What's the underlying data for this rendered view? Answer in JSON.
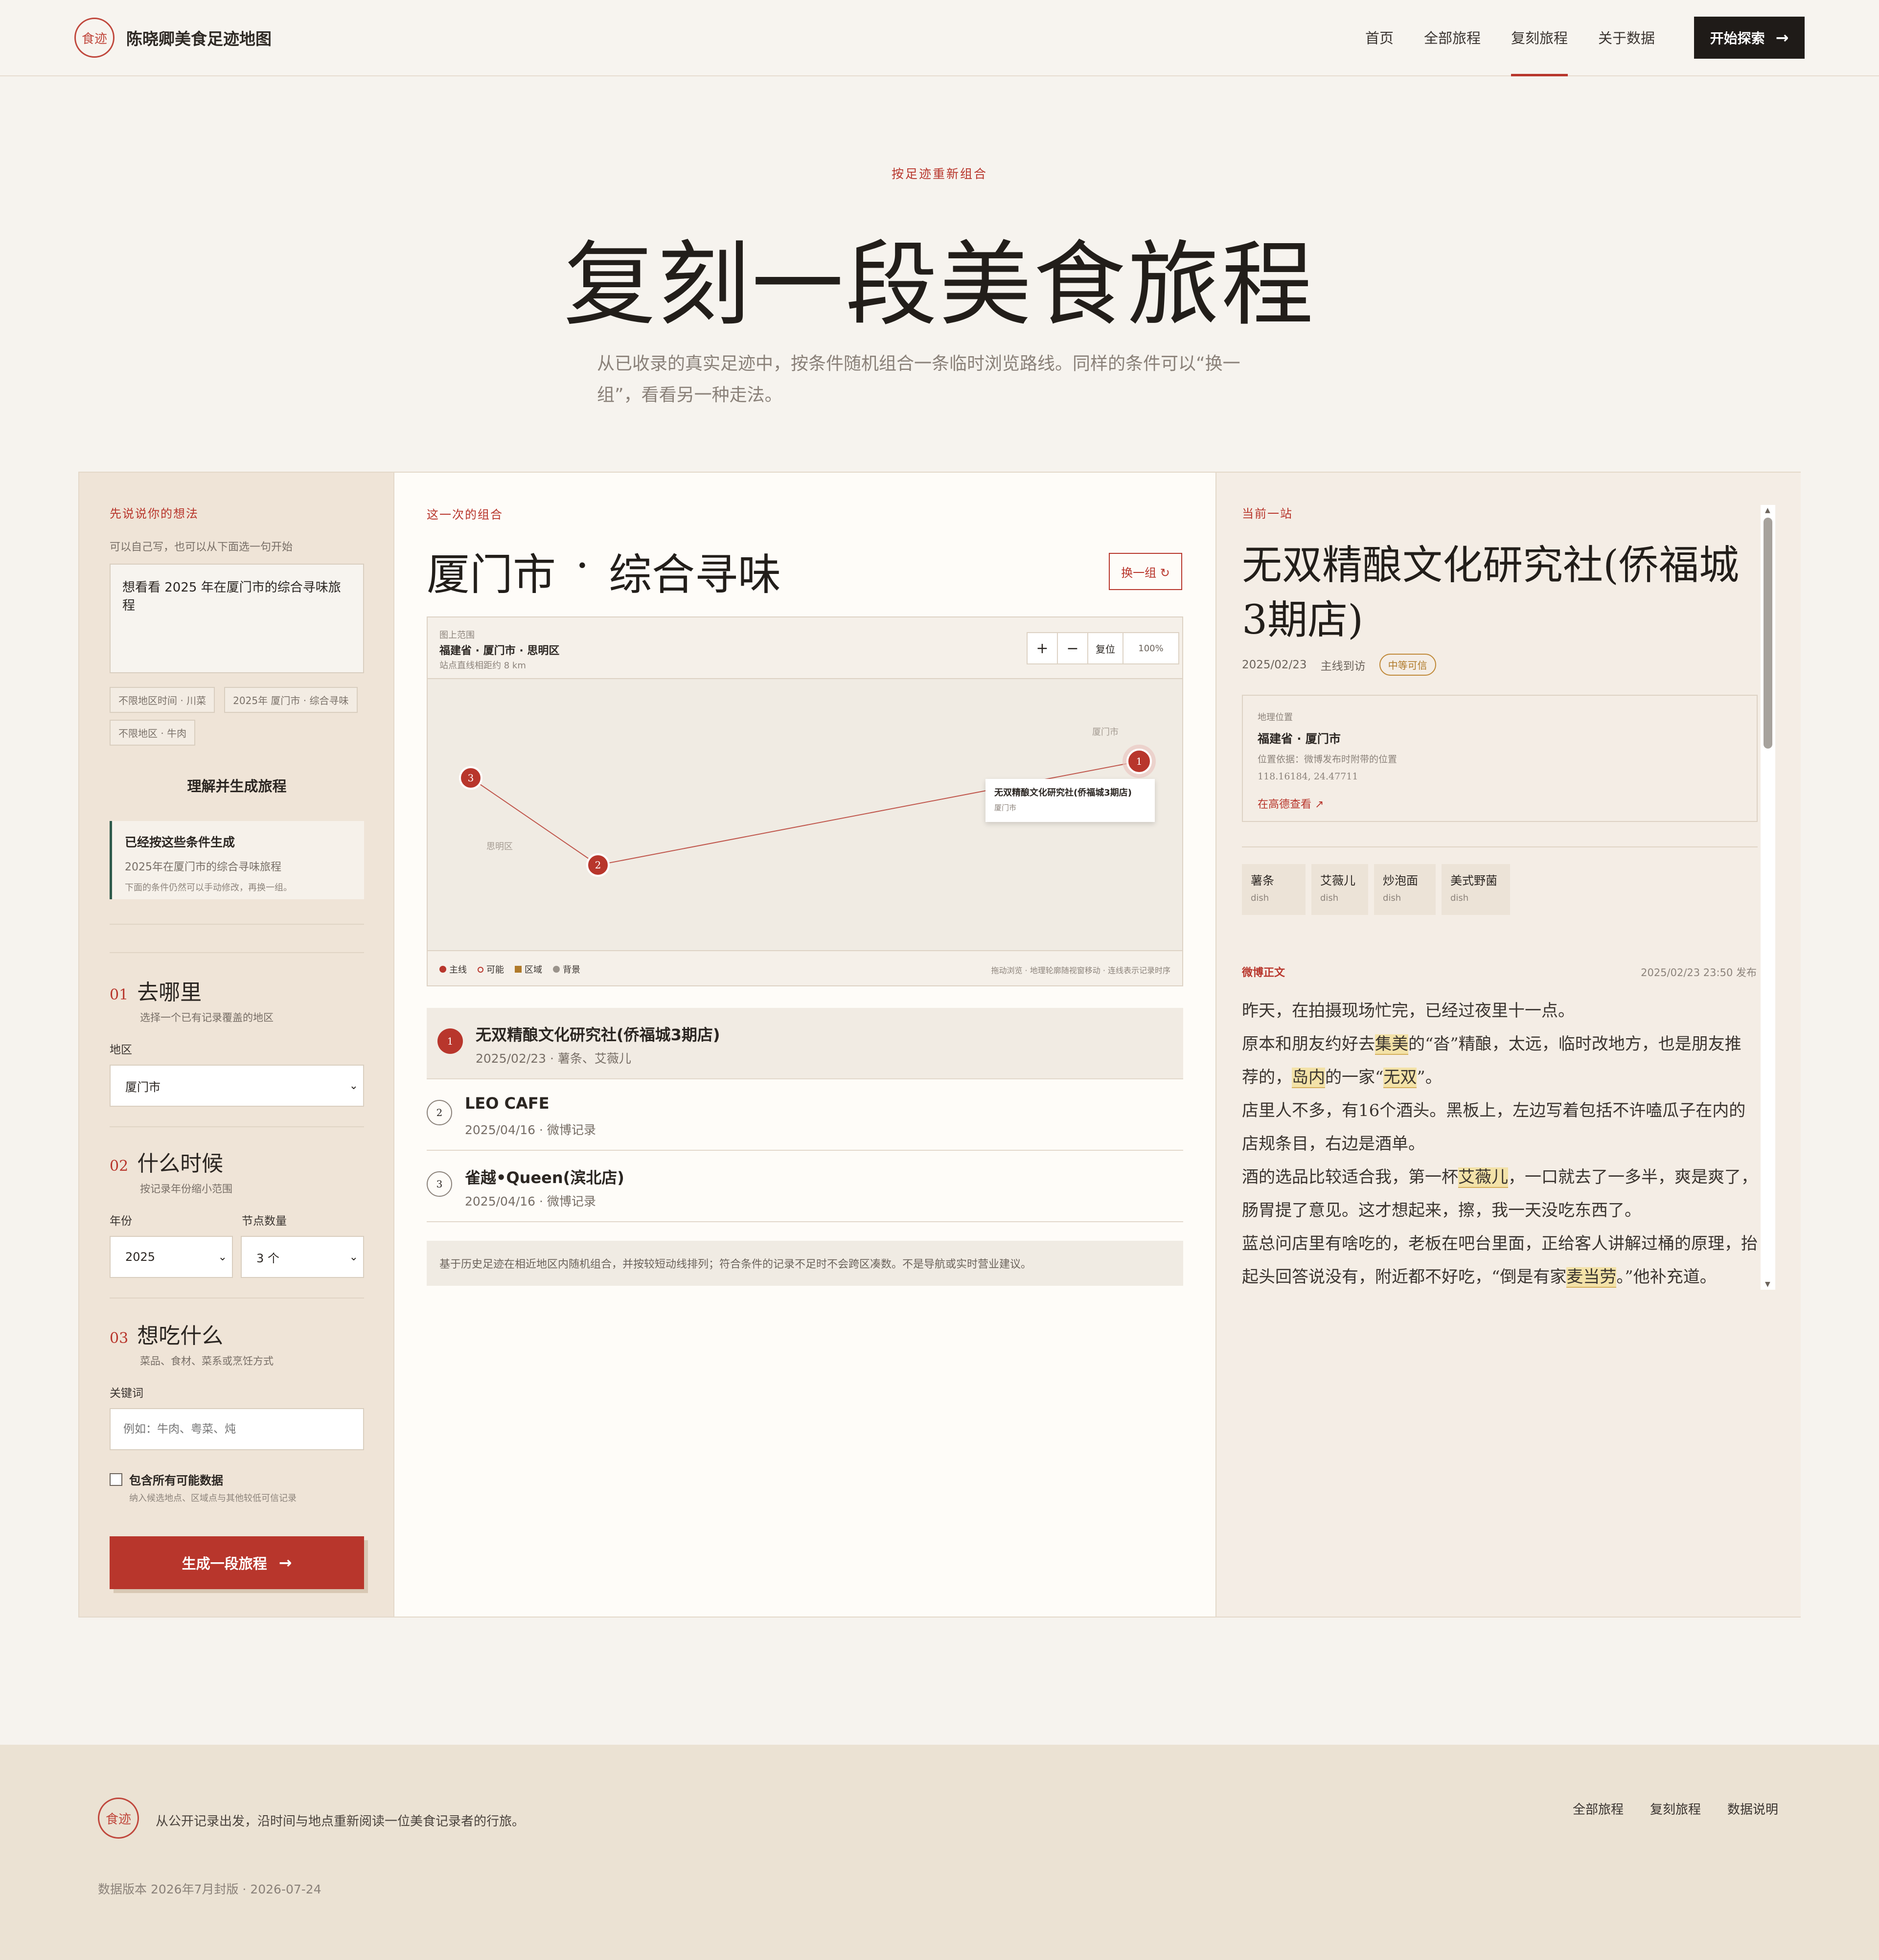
{
  "nav": {
    "logo_text": "食迹",
    "brand": "陈晓卿美食足迹地图",
    "links": [
      "首页",
      "全部旅程",
      "复刻旅程",
      "关于数据"
    ],
    "active_index": 2,
    "cta_label": "开始探索",
    "cta_arrow": "→"
  },
  "hero": {
    "eyebrow": "按足迹重新组合",
    "title": "复刻一段美食旅程",
    "description": "从已收录的真实足迹中，按条件随机组合一条临时浏览路线。同样的条件可以“换一组”，看看另一种走法。"
  },
  "left": {
    "label": "先说说你的想法",
    "hint": "可以自己写，也可以从下面选一句开始",
    "prompt_value": "想看看 2025 年在厦门市的综合寻味旅程",
    "chips": [
      "不限地区时间 · 川菜",
      "2025年 厦门市 · 综合寻味",
      "不限地区 · 牛肉"
    ],
    "parse_button": "理解并生成旅程",
    "notice_title": "已经按这些条件生成",
    "notice_line": "2025年在厦门市的综合寻味旅程",
    "notice_hint": "下面的条件仍然可以手动修改，再换一组。",
    "step1": {
      "no": "01",
      "title": "去哪里",
      "hint": "选择一个已有记录覆盖的地区",
      "field_label": "地区",
      "value": "厦门市"
    },
    "step2": {
      "no": "02",
      "title": "什么时候",
      "hint": "按记录年份缩小范围",
      "year_label": "年份",
      "year_value": "2025",
      "count_label": "节点数量",
      "count_value": "3 个"
    },
    "step3": {
      "no": "03",
      "title": "想吃什么",
      "hint": "菜品、食材、菜系或烹饪方式",
      "field_label": "关键词",
      "placeholder": "例如：牛肉、粤菜、炖"
    },
    "checkbox_label": "包含所有可能数据",
    "checkbox_hint": "纳入候选地点、区域点与其他较低可信记录",
    "checkbox_checked": false,
    "generate_button": "生成一段旅程",
    "generate_arrow": "→"
  },
  "middle": {
    "label": "这一次的组合",
    "city": "厦门市",
    "dot": "·",
    "theme": "综合寻味",
    "shuffle_label": "换一组 ↻",
    "map": {
      "scope_label": "图上范围",
      "scope": "福建省 · 厦门市 · 思明区",
      "distance": "站点直线相距约 8 km",
      "zoom_in": "+",
      "zoom_out": "−",
      "reset": "复位",
      "zoom": "100%",
      "area_label_1": "厦门市",
      "area_label_2": "思明区",
      "tooltip_title": "无双精酿文化研究社(侨福城3期店)",
      "tooltip_sub": "厦门市",
      "legend": [
        "主线",
        "可能",
        "区域",
        "背景"
      ],
      "legend_colors": [
        "#b8362c",
        "#b8362c",
        "#b07a2a",
        "#9a938b"
      ],
      "hint": "拖动浏览 · 地理轮廓随视窗移动 · 连线表示记录时序",
      "pins": [
        "1",
        "2",
        "3"
      ]
    },
    "stops": [
      {
        "no": "1",
        "name": "无双精酿文化研究社(侨福城3期店)",
        "meta": "2025/02/23 · 薯条、艾薇儿"
      },
      {
        "no": "2",
        "name": "LEO CAFE",
        "meta": "2025/04/16 · 微博记录"
      },
      {
        "no": "3",
        "name": "雀越•Queen(滨北店)",
        "meta": "2025/04/16 · 微博记录"
      }
    ],
    "disclaimer": "基于历史足迹在相近地区内随机组合，并按较短动线排列；符合条件的记录不足时不会跨区凑数。不是导航或实时营业建议。"
  },
  "right": {
    "label": "当前一站",
    "title": "无双精酿文化研究社(侨福城3期店)",
    "date": "2025/02/23",
    "visit": "主线到访",
    "badge": "中等可信",
    "geo_label": "地理位置",
    "geo_place": "福建省 · 厦门市",
    "geo_basis": "位置依据：微博发布时附带的位置",
    "geo_coords": "118.16184, 24.47711",
    "geo_link": "在高德查看 ↗",
    "tags": [
      {
        "name": "薯条",
        "type": "dish"
      },
      {
        "name": "艾薇儿",
        "type": "dish"
      },
      {
        "name": "炒泡面",
        "type": "dish"
      },
      {
        "name": "美式野菌",
        "type": "dish"
      }
    ],
    "weibo_label": "微博正文",
    "weibo_time": "2025/02/23 23:50 发布",
    "weibo": {
      "p1": "昨天，在拍摄现场忙完，已经过夜里十一点。",
      "p2a": "原本和朋友约好去",
      "p2h1": "集美",
      "p2b": "的“沓”精酿，太远，临时改地方，也是朋友推荐的，",
      "p2h2": "岛内",
      "p2c": "的一家“",
      "p2h3": "无双",
      "p2d": "”。",
      "p3": "店里人不多，有16个酒头。黑板上，左边写着包括不许嗑瓜子在内的店规条目，右边是酒单。",
      "p4a": "酒的选品比较适合我，第一杯",
      "p4h": "艾薇儿",
      "p4b": "，一口就去了一多半，爽是爽了，肠胃提了意见。这才想起来，擦，我一天没吃东西了。",
      "p5a": "蓝总问店里有啥吃的，老板在吧台里面，正给客人讲解过桶的原理，抬起头回答说没有，附近都不好吃，“倒是有家",
      "p5h": "麦当劳",
      "p5b": "。”他补充道。"
    }
  },
  "footer": {
    "logo_text": "食迹",
    "tagline": "从公开记录出发，沿时间与地点重新阅读一位美食记录者的行旅。",
    "links": [
      "全部旅程",
      "复刻旅程",
      "数据说明"
    ],
    "version": "数据版本 2026年7月封版 · 2026-07-24"
  }
}
